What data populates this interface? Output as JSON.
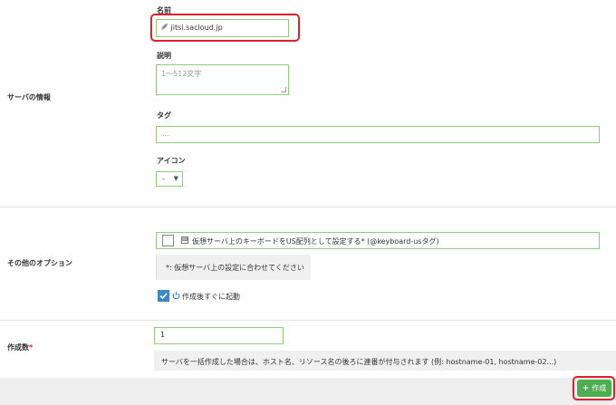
{
  "server_info": {
    "section_label": "サーバの情報",
    "name_label": "名前",
    "name_value": "jitsi.sacloud.jp",
    "description_label": "説明",
    "description_placeholder": "1～512文字",
    "tag_label": "タグ",
    "tag_placeholder": "...",
    "icon_label": "アイコン",
    "icon_select_value": "-"
  },
  "other_options": {
    "section_label": "その他のオプション",
    "keyboard_option_label": "仮想サーバ上のキーボードをUS配列として設定する* (@keyboard-usタグ)",
    "keyboard_option_checked": false,
    "keyboard_note": "*: 仮想サーバ上の設定に合わせてください",
    "boot_after_create_label": "作成後すぐに起動",
    "boot_after_create_checked": true
  },
  "count": {
    "section_label": "作成数",
    "required_mark": "*",
    "value": "1",
    "note": "サーバを一括作成した場合は、ホスト名、リソース名の後ろに連番が付与されます (例: hostname-01, hostname-02...)"
  },
  "footer": {
    "create_button_label": "作成"
  },
  "colors": {
    "accent_green": "#4caf4f",
    "input_border": "#8fcf7a",
    "highlight_red": "#e0202a",
    "checkbox_blue": "#3a88c8"
  }
}
